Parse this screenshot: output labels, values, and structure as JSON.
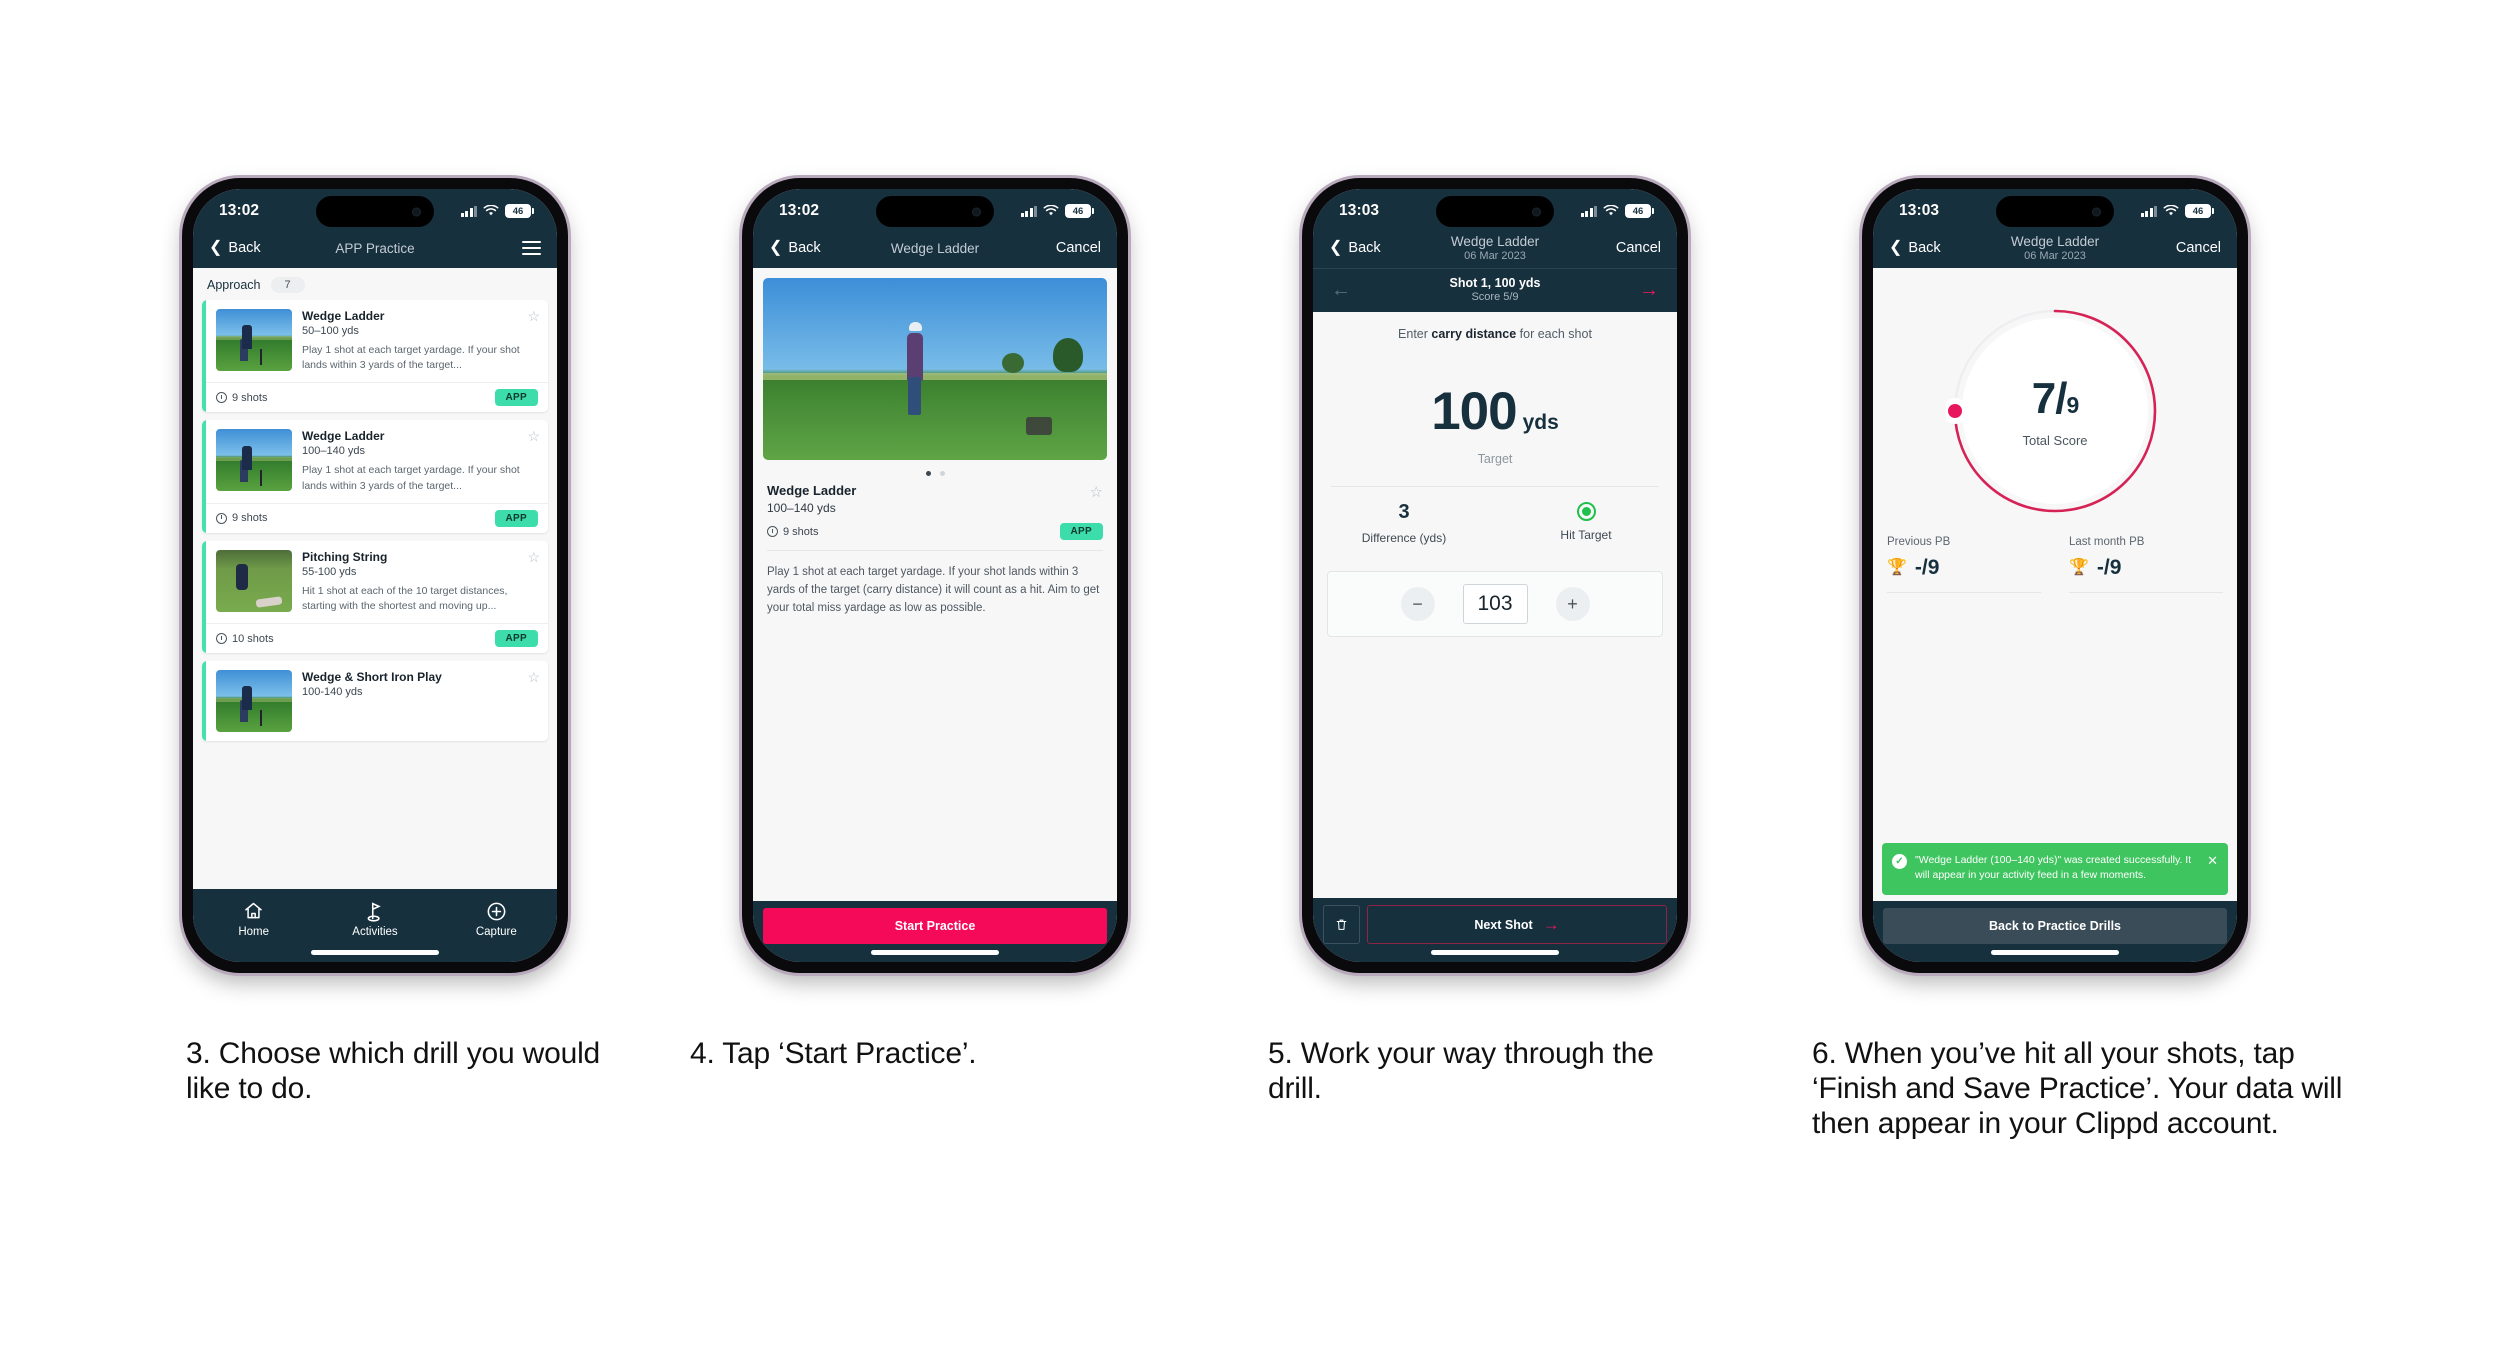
{
  "page": {
    "background": "#ffffff",
    "colors": {
      "navy": "#17303e",
      "pink": "#f50a5a",
      "pink_accent": "#e8175d",
      "teal": "#3ddcab",
      "green": "#3fc55f",
      "hit_green": "#1fc14c"
    }
  },
  "phones": [
    {
      "id": "phone-1",
      "status": {
        "time": "13:02",
        "battery": "46"
      },
      "nav": {
        "back": "Back",
        "title": "APP Practice",
        "menu_icon": "hamburger-icon"
      },
      "category": {
        "label": "Approach",
        "count": "7"
      },
      "drills": [
        {
          "name": "Wedge Ladder",
          "yardage": "50–100 yds",
          "description": "Play 1 shot at each target yardage. If your shot lands within 3 yards of the target...",
          "shots": "9 shots",
          "tag": "APP",
          "thumb": "sky"
        },
        {
          "name": "Wedge Ladder",
          "yardage": "100–140 yds",
          "description": "Play 1 shot at each target yardage. If your shot lands within 3 yards of the target...",
          "shots": "9 shots",
          "tag": "APP",
          "thumb": "sky"
        },
        {
          "name": "Pitching String",
          "yardage": "55-100 yds",
          "description": "Hit 1 shot at each of the 10 target distances, starting with the shortest and moving up...",
          "shots": "10 shots",
          "tag": "APP",
          "thumb": "green"
        },
        {
          "name": "Wedge & Short Iron Play",
          "yardage": "100-140 yds",
          "description": "",
          "shots": "",
          "tag": "",
          "thumb": "sky"
        }
      ],
      "tabs": [
        {
          "label": "Home",
          "icon": "home-icon"
        },
        {
          "label": "Activities",
          "icon": "golf-flag-icon"
        },
        {
          "label": "Capture",
          "icon": "plus-circle-icon"
        }
      ]
    },
    {
      "id": "phone-2",
      "status": {
        "time": "13:02",
        "battery": "46"
      },
      "nav": {
        "back": "Back",
        "title": "Wedge Ladder",
        "cancel": "Cancel"
      },
      "detail": {
        "title": "Wedge Ladder",
        "yardage": "100–140 yds",
        "shots": "9 shots",
        "tag": "APP",
        "description": "Play 1 shot at each target yardage. If your shot lands within 3 yards of the target (carry distance) it will count as a hit. Aim to get your total miss yardage as low as possible."
      },
      "cta": "Start Practice"
    },
    {
      "id": "phone-3",
      "status": {
        "time": "13:03",
        "battery": "46"
      },
      "nav": {
        "back": "Back",
        "title": "Wedge Ladder",
        "subtitle": "06 Mar 2023",
        "cancel": "Cancel"
      },
      "shotbar": {
        "title": "Shot 1, 100 yds",
        "score": "Score 5/9",
        "prev_icon": "arrow-left-icon",
        "next_icon": "arrow-right-icon"
      },
      "hint_pre": "Enter ",
      "hint_bold": "carry distance",
      "hint_post": " for each shot",
      "target": {
        "value": "100",
        "unit": "yds",
        "label": "Target"
      },
      "stats": [
        {
          "value": "3",
          "label": "Difference (yds)"
        },
        {
          "value": "",
          "label": "Hit Target",
          "icon": "target-hit-icon"
        }
      ],
      "stepper": {
        "minus": "−",
        "value": "103",
        "plus": "+"
      },
      "footer": {
        "delete_icon": "trash-icon",
        "next": "Next Shot",
        "next_icon": "arrow-right-icon"
      }
    },
    {
      "id": "phone-4",
      "status": {
        "time": "13:03",
        "battery": "46"
      },
      "nav": {
        "back": "Back",
        "title": "Wedge Ladder",
        "subtitle": "06 Mar 2023",
        "cancel": "Cancel"
      },
      "ring": {
        "score": "7",
        "separator": "/",
        "total": "9",
        "label": "Total Score",
        "percent": 78
      },
      "pbs": [
        {
          "label": "Previous PB",
          "value": "-/9",
          "icon": "trophy-icon"
        },
        {
          "label": "Last month PB",
          "value": "-/9",
          "icon": "trophy-icon"
        }
      ],
      "toast": {
        "text": "\"Wedge Ladder (100–140 yds)\" was created successfully. It will appear in your activity feed in a few moments.",
        "check_icon": "check-icon",
        "close_icon": "close-icon"
      },
      "footer": {
        "button": "Back to Practice Drills"
      }
    }
  ],
  "captions": [
    "3. Choose which drill you would like to do.",
    "4. Tap ‘Start Practice’.",
    "5. Work your way through the drill.",
    "6. When you’ve hit all your shots, tap ‘Finish and Save Practice’. Your data will then appear in your Clippd account."
  ]
}
